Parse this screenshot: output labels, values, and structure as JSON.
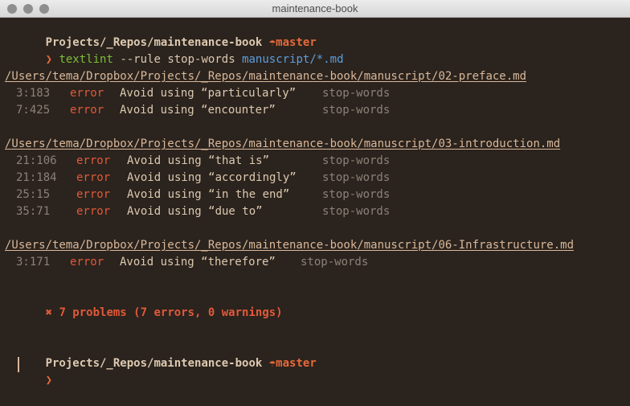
{
  "window": {
    "title": "maintenance-book"
  },
  "colors": {
    "background": "#2b231d",
    "error": "#e05a3a",
    "path": "#d9b89a",
    "command": "#7bbf3a",
    "arg": "#5b9fe0",
    "muted": "#8b8278"
  },
  "prompt": {
    "cwd": "Projects/_Repos/maintenance-book",
    "branch_icon": "umbrella-icon",
    "branch_glyph": "☂",
    "branch": "master",
    "chevron": "❯"
  },
  "command": {
    "program": "textlint",
    "flags": "--rule stop-words",
    "arg": "manuscript/*.md"
  },
  "files": [
    {
      "path": "/Users/tema/Dropbox/Projects/_Repos/maintenance-book/manuscript/02-preface.md",
      "issues": [
        {
          "loc": "3:183",
          "level": "error",
          "message": "Avoid using “particularly”",
          "rule": "stop-words"
        },
        {
          "loc": "7:425",
          "level": "error",
          "message": "Avoid using “encounter”",
          "rule": "stop-words"
        }
      ]
    },
    {
      "path": "/Users/tema/Dropbox/Projects/_Repos/maintenance-book/manuscript/03-introduction.md",
      "issues": [
        {
          "loc": "21:106",
          "level": "error",
          "message": "Avoid using “that is”",
          "rule": "stop-words"
        },
        {
          "loc": "21:184",
          "level": "error",
          "message": "Avoid using “accordingly”",
          "rule": "stop-words"
        },
        {
          "loc": "25:15",
          "level": "error",
          "message": "Avoid using “in the end”",
          "rule": "stop-words"
        },
        {
          "loc": "35:71",
          "level": "error",
          "message": "Avoid using “due to”",
          "rule": "stop-words"
        }
      ]
    },
    {
      "path": "/Users/tema/Dropbox/Projects/_Repos/maintenance-book/manuscript/06-Infrastructure.md",
      "issues": [
        {
          "loc": "3:171",
          "level": "error",
          "message": "Avoid using “therefore”",
          "rule": "stop-words"
        }
      ]
    }
  ],
  "summary": {
    "icon": "✖",
    "text": "7 problems (7 errors, 0 warnings)"
  }
}
